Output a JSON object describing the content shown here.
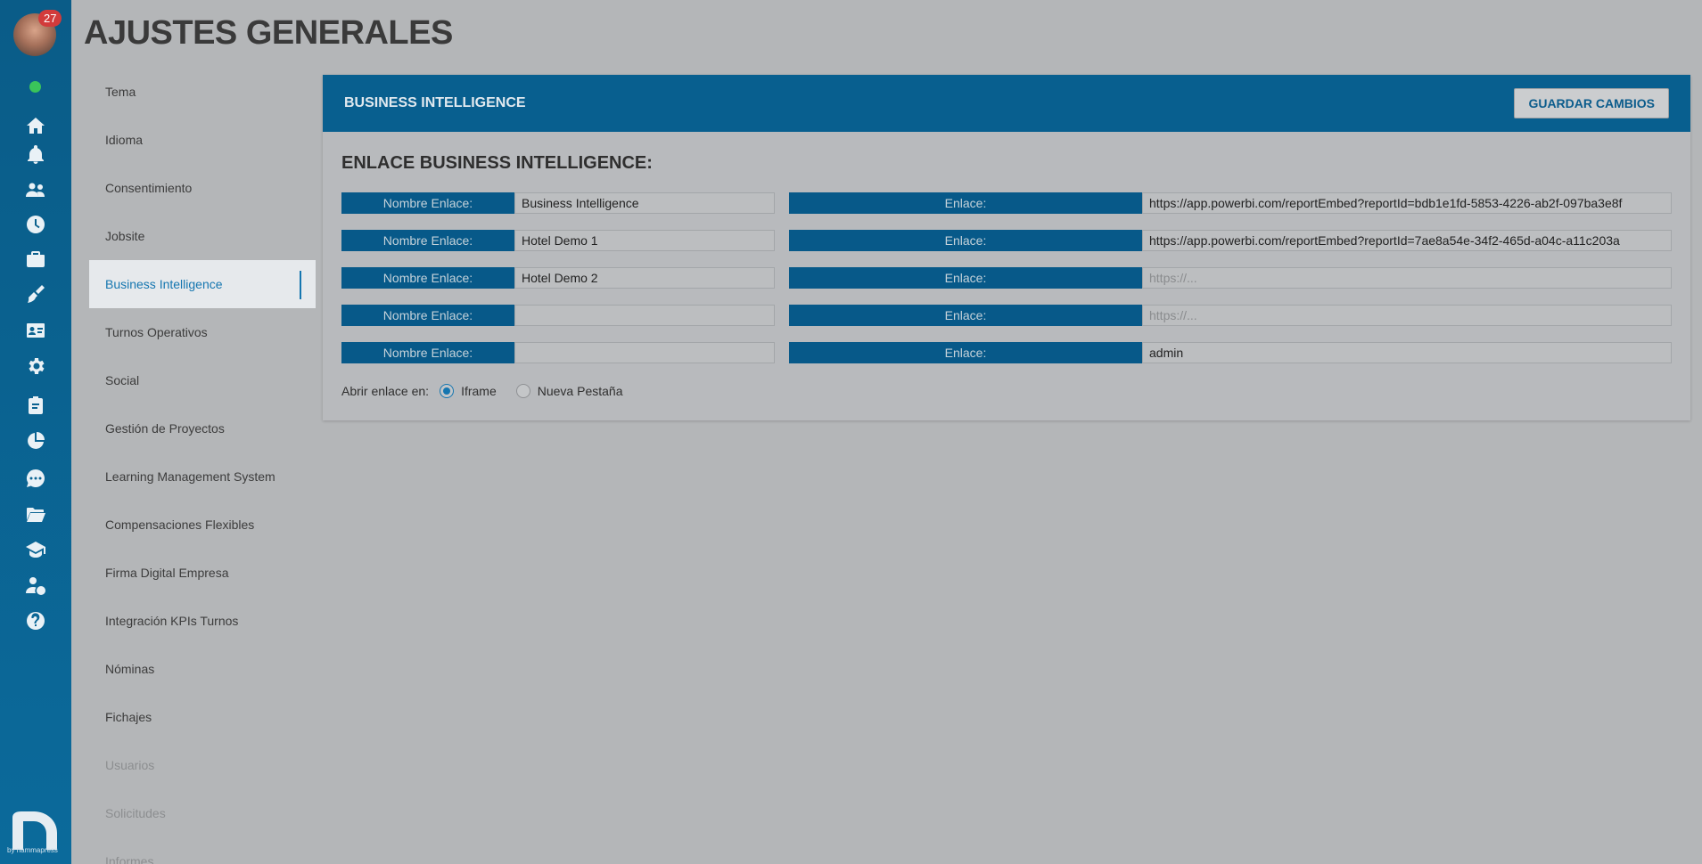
{
  "user": {
    "notification_count": "27"
  },
  "page": {
    "title": "AJUSTES GENERALES"
  },
  "menu": [
    {
      "label": "Tema",
      "state": "normal"
    },
    {
      "label": "Idioma",
      "state": "normal"
    },
    {
      "label": "Consentimiento",
      "state": "normal"
    },
    {
      "label": "Jobsite",
      "state": "normal"
    },
    {
      "label": "Business Intelligence",
      "state": "active"
    },
    {
      "label": "Turnos Operativos",
      "state": "normal"
    },
    {
      "label": "Social",
      "state": "normal"
    },
    {
      "label": "Gestión de Proyectos",
      "state": "normal"
    },
    {
      "label": "Learning Management System",
      "state": "normal"
    },
    {
      "label": "Compensaciones Flexibles",
      "state": "normal"
    },
    {
      "label": "Firma Digital Empresa",
      "state": "normal"
    },
    {
      "label": "Integración KPIs Turnos",
      "state": "normal"
    },
    {
      "label": "Nóminas",
      "state": "normal"
    },
    {
      "label": "Fichajes",
      "state": "normal"
    },
    {
      "label": "Usuarios",
      "state": "disabled"
    },
    {
      "label": "Solicitudes",
      "state": "disabled"
    },
    {
      "label": "Informes",
      "state": "disabled"
    }
  ],
  "panel": {
    "title": "BUSINESS INTELLIGENCE",
    "save_label": "GUARDAR CAMBIOS",
    "section_title": "ENLACE BUSINESS INTELLIGENCE:",
    "name_label": "Nombre Enlace:",
    "link_label": "Enlace:",
    "link_placeholder": "https://...",
    "rows": [
      {
        "name": "Business Intelligence",
        "link": "https://app.powerbi.com/reportEmbed?reportId=bdb1e1fd-5853-4226-ab2f-097ba3e8f"
      },
      {
        "name": "Hotel Demo 1",
        "link": "https://app.powerbi.com/reportEmbed?reportId=7ae8a54e-34f2-465d-a04c-a11c203a"
      },
      {
        "name": "Hotel Demo 2",
        "link": ""
      },
      {
        "name": "",
        "link": ""
      },
      {
        "name": "",
        "link": "admin"
      }
    ],
    "open_in_label": "Abrir enlace en:",
    "open_options": [
      {
        "label": "Iframe",
        "checked": true
      },
      {
        "label": "Nueva Pestaña",
        "checked": false
      }
    ]
  },
  "brand": {
    "by_text": "by nammapress"
  },
  "icons": [
    "home-icon",
    "bell-icon",
    "users-icon",
    "clock-icon",
    "briefcase-icon",
    "cleaning-icon",
    "id-card-icon",
    "gear-icon",
    "clipboard-icon",
    "pie-chart-icon",
    "chat-icon",
    "folder-icon",
    "graduation-cap-icon",
    "user-dollar-icon",
    "help-icon"
  ],
  "colors": {
    "accent": "#1576b0",
    "header": "#085f8f",
    "rail": "#0b6a9b"
  }
}
